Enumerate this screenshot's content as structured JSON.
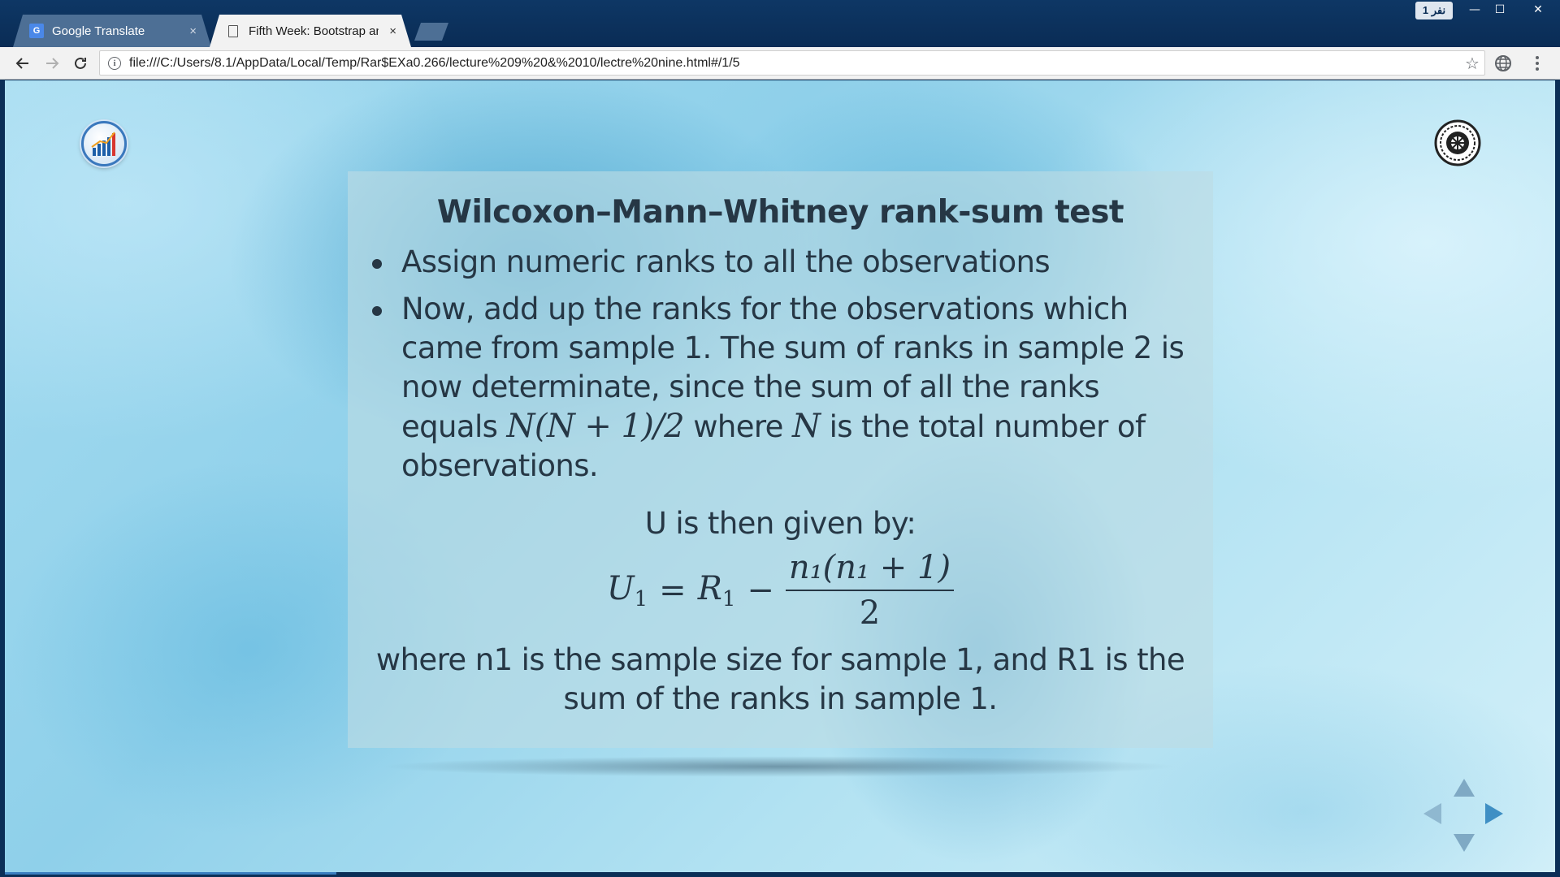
{
  "browser": {
    "tabs": [
      {
        "title": "Google Translate",
        "icon": "google-translate-icon",
        "active": false
      },
      {
        "title": "Fifth Week: Bootstrap an",
        "icon": "page-icon",
        "active": true
      }
    ],
    "tab_close": "×",
    "profile_badge": "نفر 1",
    "window_controls": {
      "minimize": "—",
      "maximize": "☐",
      "close": "✕"
    },
    "url": "file:///C:/Users/8.1/AppData/Local/Temp/Rar$EXa0.266/lecture%209%20&%2010/lectre%20nine.html#/1/5",
    "info_icon_glyph": "i",
    "star_glyph": "☆",
    "chrome_color": "#0b2f57"
  },
  "slide": {
    "title": "Wilcoxon–Mann–Whitney rank-sum test",
    "bullet1": "Assign numeric ranks to all the observations",
    "bullet2": {
      "part1": "Now, add up the ranks for the observations which came from sample 1. The sum of ranks in sample 2 is now determinate, since the sum of all the ranks equals ",
      "math1": "N(N + 1)/2",
      "part2": " where ",
      "math2": "N",
      "part3": " is the total number of observations."
    },
    "u_intro": "U is then given by:",
    "formula": {
      "lhs": "U",
      "lhs_sub": "1",
      "equals": "=",
      "r": "R",
      "r_sub": "1",
      "minus": "−",
      "numerator": "n₁(n₁ + 1)",
      "denominator": "2"
    },
    "closing": "where n1 is the sample size for sample 1, and R1 is the sum of the ranks in sample 1.",
    "text_color": "#263745"
  },
  "navigation": {
    "arrows": [
      "up",
      "down",
      "left",
      "right"
    ],
    "active_arrow_color": "#3f8fc4"
  }
}
